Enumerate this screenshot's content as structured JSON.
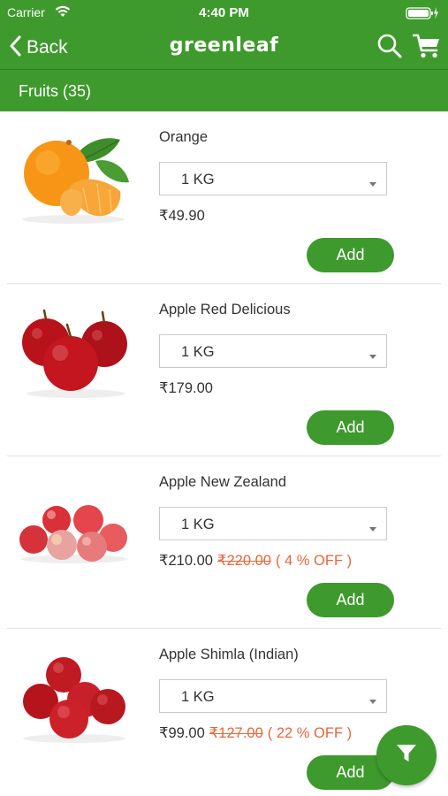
{
  "status_bar": {
    "carrier": "Carrier",
    "time": "4:40 PM",
    "wifi_icon": "wifi-icon",
    "battery_icon": "battery-charging-icon"
  },
  "nav": {
    "back_label": "Back",
    "brand": "greenleaf",
    "search_icon": "search-icon",
    "cart_icon": "cart-icon"
  },
  "category": {
    "title": "Fruits (35)"
  },
  "products": [
    {
      "name": "Orange",
      "quantity": "1 KG",
      "price": "₹49.90",
      "original_price": "",
      "discount": "",
      "add_label": "Add",
      "image": "orange-image"
    },
    {
      "name": "Apple Red Delicious",
      "quantity": "1 KG",
      "price": "₹179.00",
      "original_price": "",
      "discount": "",
      "add_label": "Add",
      "image": "red-apples-image"
    },
    {
      "name": "Apple New Zealand",
      "quantity": "1 KG",
      "price": "₹210.00",
      "original_price": "₹220.00",
      "discount": "( 4 % OFF )",
      "add_label": "Add",
      "image": "nz-apples-image"
    },
    {
      "name": "Apple Shimla (Indian)",
      "quantity": "1 KG",
      "price": "₹99.00",
      "original_price": "₹127.00",
      "discount": "( 22 % OFF )",
      "add_label": "Add",
      "image": "shimla-apples-image"
    }
  ],
  "colors": {
    "brand_green": "#3e9a2d",
    "discount_orange": "#e8663a"
  },
  "filter_icon": "filter-icon"
}
